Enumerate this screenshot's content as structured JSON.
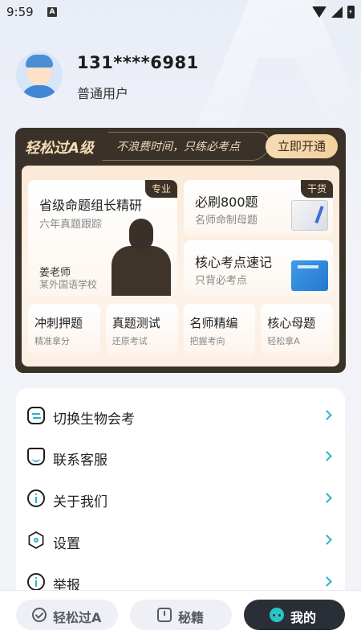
{
  "status_bar": {
    "time": "9:59",
    "notification_badge": "A"
  },
  "profile": {
    "phone": "131****6981",
    "user_type": "普通用户"
  },
  "vip": {
    "title": "轻松过A级",
    "slogan": "不浪费时间，只练必考点",
    "button": "立即开通",
    "featured": {
      "tag": "专业",
      "title": "省级命题组长精研",
      "subtitle": "六年真题跟踪",
      "teacher_name": "姜老师",
      "teacher_school": "某外国语学校"
    },
    "side_cards": [
      {
        "tag": "干货",
        "title": "必刷800题",
        "subtitle": "名师命制母题",
        "icon": "exercise-book-icon"
      },
      {
        "title": "核心考点速记",
        "subtitle": "只背必考点",
        "icon": "notes-book-icon"
      }
    ],
    "mini_cards": [
      {
        "title": "冲刺押题",
        "subtitle": "精准拿分"
      },
      {
        "title": "真题测试",
        "subtitle": "还原考试"
      },
      {
        "title": "名师精编",
        "subtitle": "把握考向"
      },
      {
        "title": "核心母题",
        "subtitle": "轻松拿A"
      }
    ]
  },
  "menu": [
    {
      "label": "切换生物会考",
      "icon": "switch-icon"
    },
    {
      "label": "联系客服",
      "icon": "customer-service-icon"
    },
    {
      "label": "关于我们",
      "icon": "info-icon"
    },
    {
      "label": "设置",
      "icon": "gear-icon"
    },
    {
      "label": "举报",
      "icon": "report-icon"
    }
  ],
  "bottom_nav": [
    {
      "label": "轻松过A",
      "icon": "check-circle-icon",
      "active": false
    },
    {
      "label": "秘籍",
      "icon": "book-icon",
      "active": false
    },
    {
      "label": "我的",
      "icon": "profile-face-icon",
      "active": true
    }
  ],
  "colors": {
    "accent": "#29b5c7",
    "vip_dark": "#3a3229",
    "vip_gold": "#f6dcb4",
    "nav_active": "#2a2e36"
  }
}
